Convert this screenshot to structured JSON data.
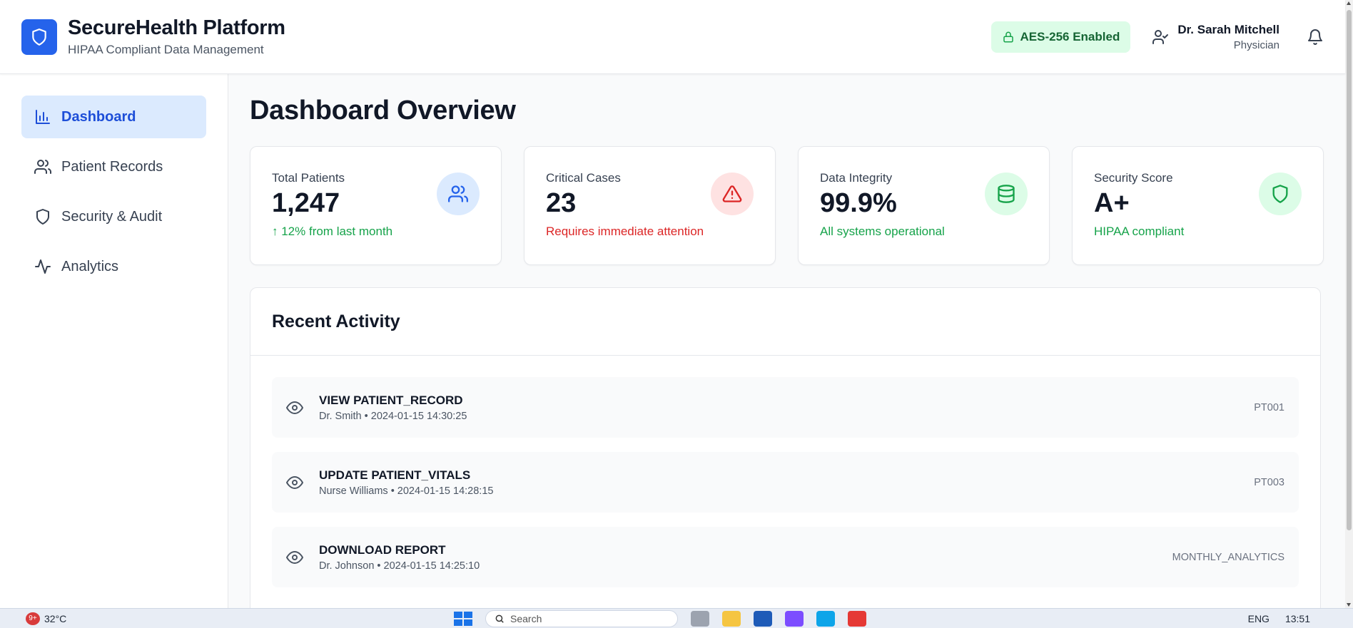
{
  "header": {
    "app_title": "SecureHealth Platform",
    "app_subtitle": "HIPAA Compliant Data Management",
    "encryption_badge": "AES-256 Enabled",
    "user_name": "Dr. Sarah Mitchell",
    "user_role": "Physician"
  },
  "sidebar": {
    "items": [
      {
        "label": "Dashboard",
        "icon": "bar-chart-icon",
        "active": true
      },
      {
        "label": "Patient Records",
        "icon": "users-icon",
        "active": false
      },
      {
        "label": "Security & Audit",
        "icon": "shield-icon",
        "active": false
      },
      {
        "label": "Analytics",
        "icon": "activity-icon",
        "active": false
      }
    ]
  },
  "main": {
    "title": "Dashboard Overview",
    "stats": [
      {
        "label": "Total Patients",
        "value": "1,247",
        "note": "↑ 12% from last month",
        "note_color": "#16a34a",
        "icon": "users-icon",
        "icon_bg": "#dbeafe",
        "icon_color": "#2563eb"
      },
      {
        "label": "Critical Cases",
        "value": "23",
        "note": "Requires immediate attention",
        "note_color": "#dc2626",
        "icon": "alert-triangle-icon",
        "icon_bg": "#fee2e2",
        "icon_color": "#dc2626"
      },
      {
        "label": "Data Integrity",
        "value": "99.9%",
        "note": "All systems operational",
        "note_color": "#16a34a",
        "icon": "database-icon",
        "icon_bg": "#dcfce7",
        "icon_color": "#16a34a"
      },
      {
        "label": "Security Score",
        "value": "A+",
        "note": "HIPAA compliant",
        "note_color": "#16a34a",
        "icon": "shield-icon",
        "icon_bg": "#dcfce7",
        "icon_color": "#16a34a"
      }
    ],
    "activity": {
      "title": "Recent Activity",
      "items": [
        {
          "action": "VIEW PATIENT_RECORD",
          "meta": "Dr. Smith • 2024-01-15 14:30:25",
          "ref": "PT001",
          "icon": "eye-icon"
        },
        {
          "action": "UPDATE PATIENT_VITALS",
          "meta": "Nurse Williams • 2024-01-15 14:28:15",
          "ref": "PT003",
          "icon": "eye-icon"
        },
        {
          "action": "DOWNLOAD REPORT",
          "meta": "Dr. Johnson • 2024-01-15 14:25:10",
          "ref": "MONTHLY_ANALYTICS",
          "icon": "eye-icon"
        }
      ]
    }
  },
  "taskbar": {
    "notifications": "9+",
    "temperature": "32°C",
    "search_placeholder": "Search",
    "language": "ENG",
    "time": "13:51"
  }
}
